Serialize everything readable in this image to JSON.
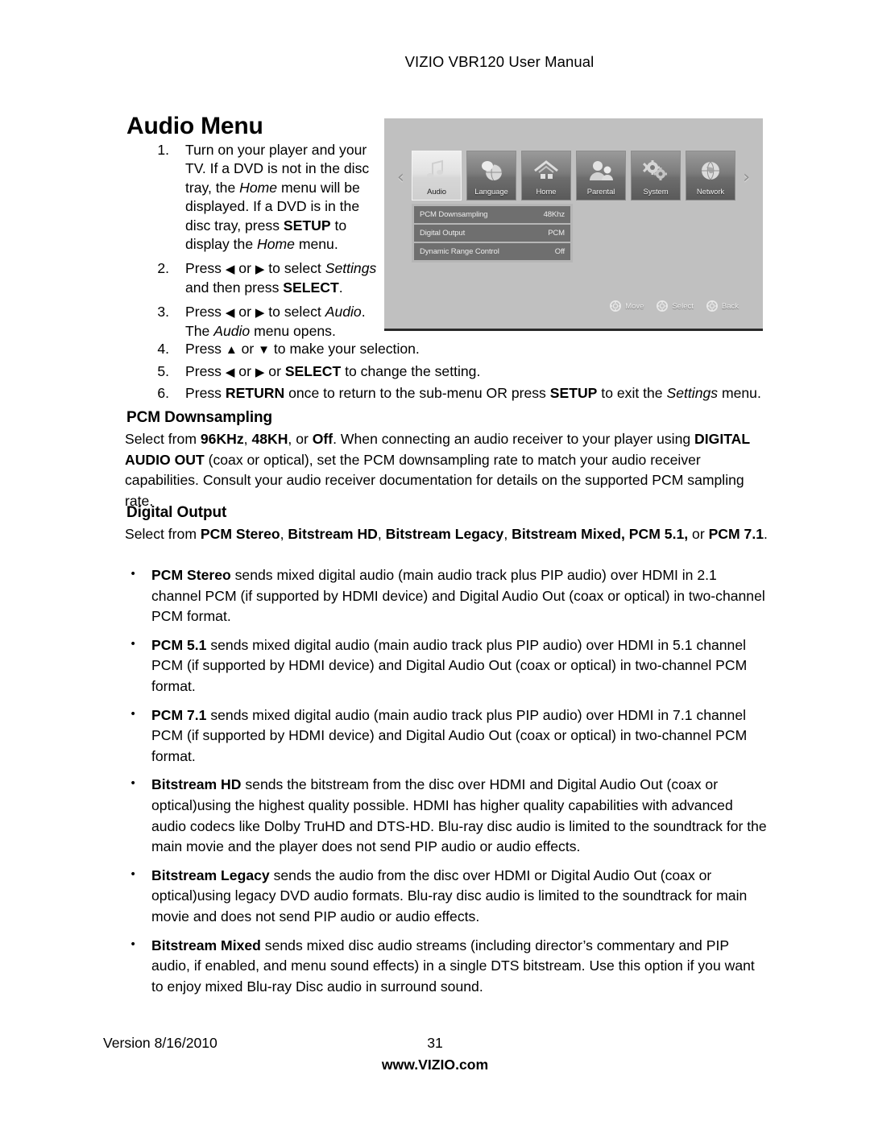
{
  "header": {
    "manual_title": "VIZIO VBR120 User Manual"
  },
  "page_title": "Audio Menu",
  "steps": [
    {
      "num": "1.",
      "parts": [
        {
          "t": "Turn on your player and your TV. If a DVD is not in the disc tray, the ",
          "s": "n"
        },
        {
          "t": "Home",
          "s": "i"
        },
        {
          "t": " menu will be displayed. If a DVD is in the disc tray, press ",
          "s": "n"
        },
        {
          "t": "SETUP",
          "s": "b"
        },
        {
          "t": " to display the ",
          "s": "n"
        },
        {
          "t": "Home",
          "s": "i"
        },
        {
          "t": " menu.",
          "s": "n"
        }
      ]
    },
    {
      "num": "2.",
      "parts": [
        {
          "t": "Press ",
          "s": "n"
        },
        {
          "t": "◀",
          "s": "a"
        },
        {
          "t": " or ",
          "s": "n"
        },
        {
          "t": "▶",
          "s": "a"
        },
        {
          "t": " to select ",
          "s": "n"
        },
        {
          "t": "Settings",
          "s": "i"
        },
        {
          "t": " and then press ",
          "s": "n"
        },
        {
          "t": "SELECT",
          "s": "b"
        },
        {
          "t": ".",
          "s": "n"
        }
      ]
    },
    {
      "num": "3.",
      "parts": [
        {
          "t": "Press ",
          "s": "n"
        },
        {
          "t": "◀",
          "s": "a"
        },
        {
          "t": " or ",
          "s": "n"
        },
        {
          "t": "▶",
          "s": "a"
        },
        {
          "t": " to select ",
          "s": "n"
        },
        {
          "t": "Audio",
          "s": "i"
        },
        {
          "t": ". The ",
          "s": "n"
        },
        {
          "t": "Audio",
          "s": "i"
        },
        {
          "t": " menu opens.",
          "s": "n"
        }
      ]
    },
    {
      "num": "4.",
      "parts": [
        {
          "t": "Press ",
          "s": "n"
        },
        {
          "t": "▲",
          "s": "a"
        },
        {
          "t": " or ",
          "s": "n"
        },
        {
          "t": "▼",
          "s": "a"
        },
        {
          "t": " to make your selection.",
          "s": "n"
        }
      ]
    },
    {
      "num": "5.",
      "parts": [
        {
          "t": "Press ",
          "s": "n"
        },
        {
          "t": "◀",
          "s": "a"
        },
        {
          "t": " or ",
          "s": "n"
        },
        {
          "t": "▶",
          "s": "a"
        },
        {
          "t": " or ",
          "s": "n"
        },
        {
          "t": "SELECT",
          "s": "b"
        },
        {
          "t": " to change the setting.",
          "s": "n"
        }
      ]
    },
    {
      "num": "6.",
      "parts": [
        {
          "t": "Press ",
          "s": "n"
        },
        {
          "t": "RETURN",
          "s": "b"
        },
        {
          "t": " once to return to the sub-menu OR press ",
          "s": "n"
        },
        {
          "t": "SETUP",
          "s": "b"
        },
        {
          "t": " to exit the ",
          "s": "n"
        },
        {
          "t": "Settings",
          "s": "i"
        },
        {
          "t": " menu.",
          "s": "n"
        }
      ]
    }
  ],
  "device_screenshot": {
    "tabs": [
      {
        "label": "Audio",
        "icon": "music-note-icon",
        "selected": true
      },
      {
        "label": "Language",
        "icon": "globe-speech-icon",
        "selected": false
      },
      {
        "label": "Home",
        "icon": "home-icon",
        "selected": false
      },
      {
        "label": "Parental",
        "icon": "people-icon",
        "selected": false
      },
      {
        "label": "System",
        "icon": "gears-icon",
        "selected": false
      },
      {
        "label": "Network",
        "icon": "globe-icon",
        "selected": false
      }
    ],
    "nav_prev": "‹",
    "nav_next": "›",
    "settings_rows": [
      {
        "name": "PCM Downsampling",
        "value": "48Khz"
      },
      {
        "name": "Digital Output",
        "value": "PCM"
      },
      {
        "name": "Dynamic Range Control",
        "value": "Off"
      }
    ],
    "hints": [
      {
        "label": "Move",
        "icon": "dpad-move-icon"
      },
      {
        "label": "Select",
        "icon": "dpad-select-icon"
      },
      {
        "label": "Back",
        "icon": "dpad-back-icon"
      }
    ]
  },
  "sections": [
    {
      "heading": "PCM Downsampling",
      "body": [
        {
          "t": "Select from ",
          "s": "n"
        },
        {
          "t": "96KHz",
          "s": "b"
        },
        {
          "t": ", ",
          "s": "n"
        },
        {
          "t": "48KH",
          "s": "b"
        },
        {
          "t": ", or ",
          "s": "n"
        },
        {
          "t": "Off",
          "s": "b"
        },
        {
          "t": ". When connecting an audio receiver to your player using ",
          "s": "n"
        },
        {
          "t": "DIGITAL AUDIO OUT",
          "s": "b"
        },
        {
          "t": " (coax or optical), set the PCM downsampling rate to match your audio receiver capabilities. Consult your audio receiver documentation for details on the supported PCM sampling rate.",
          "s": "n"
        }
      ]
    },
    {
      "heading": "Digital Output",
      "body": [
        {
          "t": "Select from ",
          "s": "n"
        },
        {
          "t": "PCM Stereo",
          "s": "b"
        },
        {
          "t": ", ",
          "s": "n"
        },
        {
          "t": "Bitstream HD",
          "s": "b"
        },
        {
          "t": ", ",
          "s": "n"
        },
        {
          "t": "Bitstream Legacy",
          "s": "b"
        },
        {
          "t": ", ",
          "s": "n"
        },
        {
          "t": "Bitstream Mixed, PCM 5.1,",
          "s": "b"
        },
        {
          "t": " or ",
          "s": "n"
        },
        {
          "t": "PCM 7.1",
          "s": "b"
        },
        {
          "t": ".",
          "s": "n"
        }
      ]
    }
  ],
  "bullets": [
    {
      "marker": "•",
      "parts": [
        {
          "t": "PCM Stereo",
          "s": "b"
        },
        {
          "t": " sends mixed digital audio (main audio track plus PIP audio) over HDMI in 2.1 channel PCM (if supported by HDMI device) and Digital Audio Out (coax or optical) in two-channel PCM format.",
          "s": "n"
        }
      ]
    },
    {
      "marker": "•",
      "parts": [
        {
          "t": "PCM 5.1",
          "s": "b"
        },
        {
          "t": " sends mixed digital audio (main audio track plus PIP audio) over HDMI in 5.1 channel PCM (if supported by HDMI device) and Digital Audio Out (coax or optical) in two-channel PCM format.",
          "s": "n"
        }
      ]
    },
    {
      "marker": "•",
      "parts": [
        {
          "t": "PCM 7.1",
          "s": "b"
        },
        {
          "t": " sends mixed digital audio (main audio track plus PIP audio) over HDMI in 7.1 channel PCM (if supported by HDMI device) and Digital Audio Out (coax or optical) in two-channel PCM format.",
          "s": "n"
        }
      ]
    },
    {
      "marker": "•",
      "parts": [
        {
          "t": "Bitstream HD",
          "s": "b"
        },
        {
          "t": " sends the bitstream from the disc over HDMI and Digital Audio Out (coax or optical)using the highest quality possible. HDMI has higher quality capabilities with advanced audio codecs like Dolby TruHD and DTS-HD. Blu-ray disc audio is limited to the soundtrack for the main movie and the player does not send PIP audio or audio effects.",
          "s": "n"
        }
      ]
    },
    {
      "marker": "•",
      "parts": [
        {
          "t": "Bitstream Legacy",
          "s": "b"
        },
        {
          "t": " sends the audio from the disc over HDMI or Digital Audio Out (coax or optical)using legacy DVD audio formats. Blu-ray disc audio is limited to the soundtrack for main movie and does not send PIP audio or audio effects.",
          "s": "n"
        }
      ]
    },
    {
      "marker": "•",
      "parts": [
        {
          "t": "Bitstream Mixed",
          "s": "b"
        },
        {
          "t": " sends mixed disc audio streams (including director’s commentary and PIP audio, if enabled, and menu sound effects) in a single DTS bitstream. Use this option if you want to enjoy mixed Blu-ray Disc audio in surround sound.",
          "s": "n"
        }
      ]
    }
  ],
  "footer": {
    "version": "Version 8/16/2010",
    "page_number": "31",
    "website": "www.VIZIO.com"
  }
}
